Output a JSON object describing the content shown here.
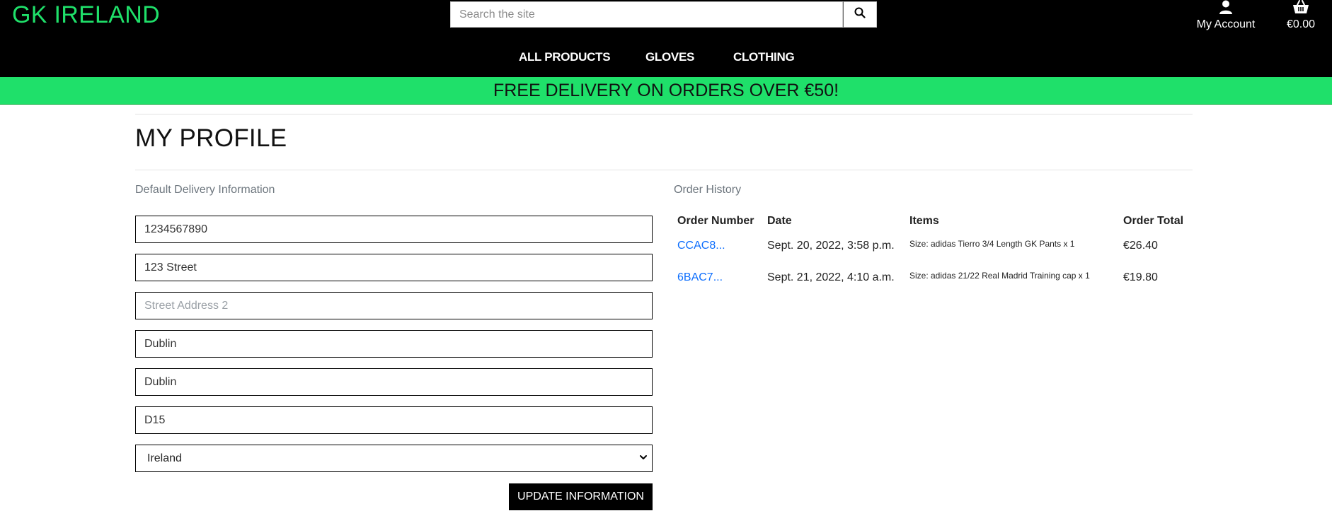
{
  "header": {
    "logo": "GK IRELAND",
    "search_placeholder": "Search the site",
    "account_label": "My Account",
    "cart_total": "€0.00"
  },
  "nav": {
    "all_products": "ALL PRODUCTS",
    "gloves": "GLOVES",
    "clothing": "CLOTHING"
  },
  "banner": "FREE DELIVERY ON ORDERS OVER €50!",
  "profile": {
    "title": "MY PROFILE",
    "delivery_heading": "Default Delivery Information",
    "fields": {
      "phone": "1234567890",
      "street1": "123 Street",
      "street2_placeholder": "Street Address 2",
      "town": "Dublin",
      "county": "Dublin",
      "postcode": "D15"
    },
    "country_selected": "Ireland",
    "update_button": "UPDATE INFORMATION"
  },
  "orders": {
    "heading": "Order History",
    "columns": [
      "Order Number",
      "Date",
      "Items",
      "Order Total"
    ],
    "rows": [
      {
        "number": "CCAC8...",
        "date": "Sept. 20, 2022, 3:58 p.m.",
        "items": "Size: adidas Tierro 3/4 Length GK Pants x 1",
        "total": "€26.40"
      },
      {
        "number": "6BAC7...",
        "date": "Sept. 21, 2022, 4:10 a.m.",
        "items": "Size: adidas 21/22 Real Madrid Training cap x 1",
        "total": "€19.80"
      }
    ]
  },
  "colors": {
    "brand_green": "#1fe06a",
    "header_bg": "#000000",
    "link_blue": "#0d6efd"
  }
}
